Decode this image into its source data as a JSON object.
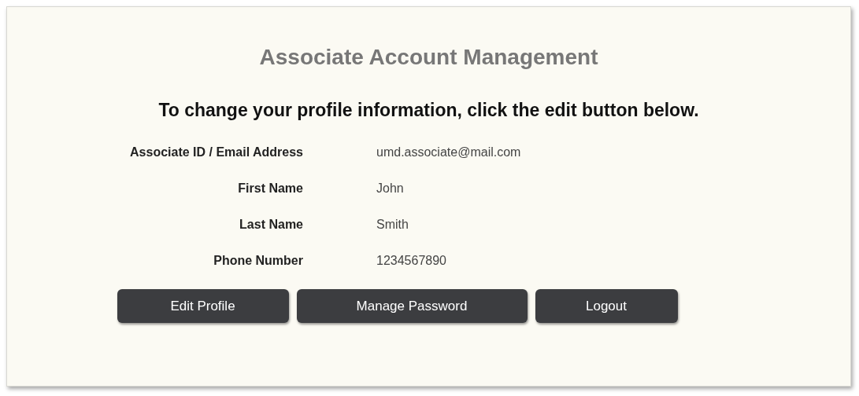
{
  "title": "Associate Account Management",
  "instruction": "To change your profile information, click the edit button below.",
  "fields": [
    {
      "label": "Associate ID / Email Address",
      "value": "umd.associate@mail.com"
    },
    {
      "label": "First Name",
      "value": "John"
    },
    {
      "label": "Last Name",
      "value": "Smith"
    },
    {
      "label": "Phone Number",
      "value": "1234567890"
    }
  ],
  "buttons": [
    "Edit Profile",
    "Manage Password",
    "Logout"
  ]
}
